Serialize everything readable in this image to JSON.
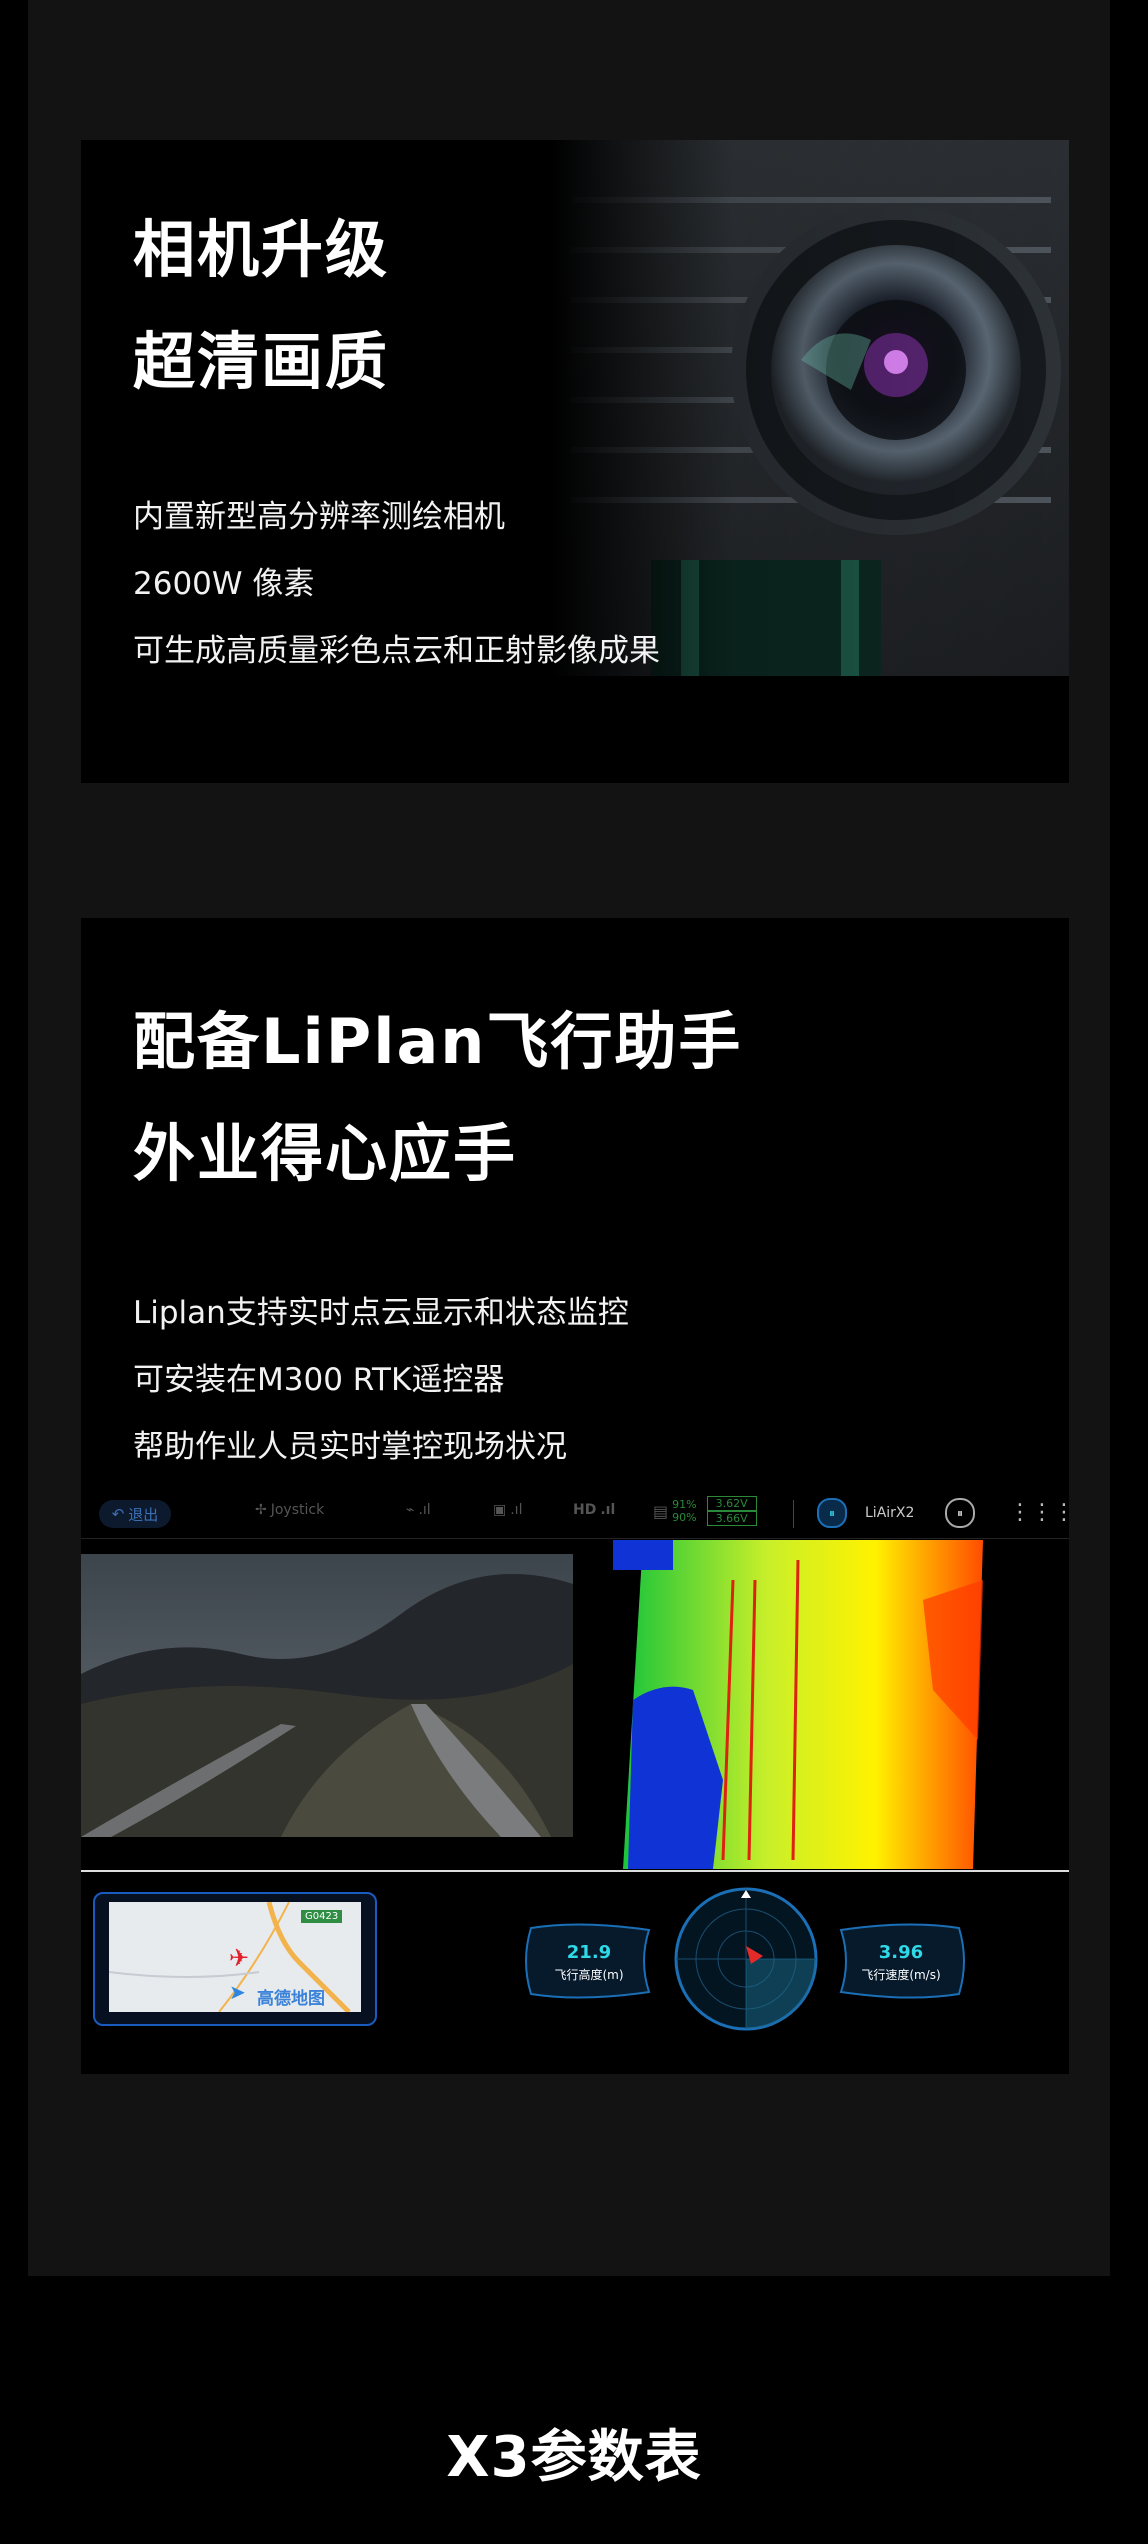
{
  "card1": {
    "headline": [
      "相机升级",
      "超清画质"
    ],
    "desc": [
      "内置新型高分辨率测绘相机",
      "2600W 像素",
      "可生成高质量彩色点云和正射影像成果"
    ]
  },
  "card2": {
    "headline": [
      "配备LiPlan飞行助手",
      "外业得心应手"
    ],
    "desc": [
      "Liplan支持实时点云显示和状态监控",
      "可安装在M300 RTK遥控器",
      "帮助作业人员实时掌控现场状况"
    ]
  },
  "app": {
    "exit_label": "退出",
    "joystick_label": "Joystick",
    "hd_label": "HD",
    "battery_pct_1": "91%",
    "battery_pct_2": "90%",
    "voltage_1": "3.62V",
    "voltage_2": "3.66V",
    "device_label": "LiAirX2",
    "map_road_label": "G0423",
    "map_brand_label": "高德地图",
    "altitude_value": "21.9",
    "altitude_label": "飞行高度(m)",
    "speed_value": "3.96",
    "speed_label": "飞行速度(m/s)"
  },
  "footer": {
    "title": "X3参数表"
  },
  "colors": {
    "accent_cyan": "#2fd9e8",
    "accent_blue": "#1a5bbf",
    "background": "#000000",
    "panel": "#131313"
  }
}
